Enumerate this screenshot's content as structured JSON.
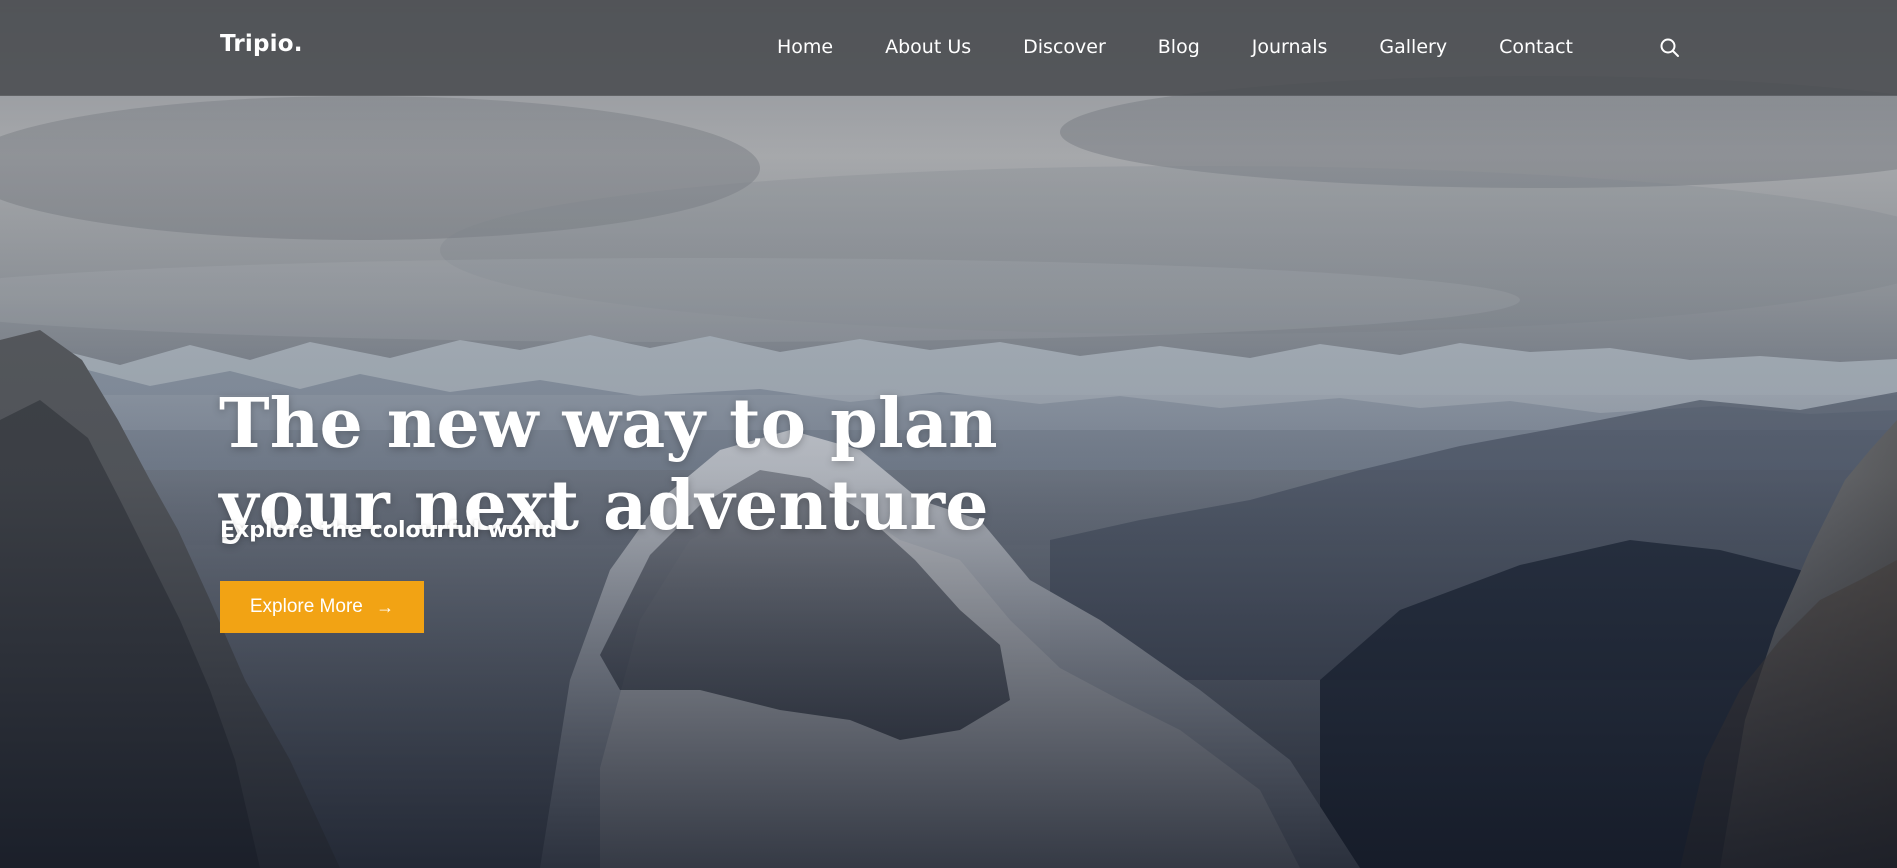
{
  "site": {
    "logo": "Tripio."
  },
  "navbar": {
    "links": [
      "Home",
      "About Us",
      "Discover",
      "Blog",
      "Journals",
      "Gallery",
      "Contact"
    ],
    "search_icon": "search-icon"
  },
  "hero": {
    "headline_line_1": "The new way to plan",
    "headline_line_2": "your next adventure",
    "subheadline": "Explore the colourful world",
    "button_label": "Explore More",
    "button_icon": "arrow-right-icon"
  },
  "colors": {
    "accent": "#f2a314",
    "text": "#ffffff",
    "navbar_overlay": "#484a4e"
  }
}
